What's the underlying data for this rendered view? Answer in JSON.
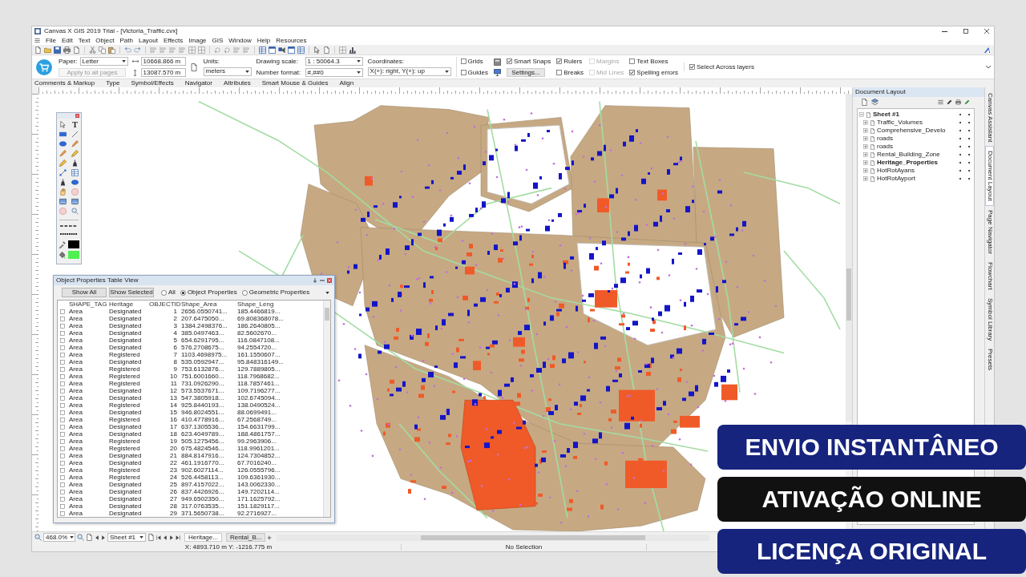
{
  "window": {
    "title": "Canvas X GIS 2019 Trial - [Victoria_Traffic.cvx]"
  },
  "menu": [
    "File",
    "Edit",
    "Text",
    "Object",
    "Path",
    "Layout",
    "Effects",
    "Image",
    "GIS",
    "Window",
    "Help",
    "Resources"
  ],
  "ribbon": {
    "paper": {
      "label": "Paper:",
      "value": "Letter"
    },
    "apply_button": {
      "label": "Apply to all pages",
      "disabled": true
    },
    "width": "10668.866 m",
    "height": "13087.570 m",
    "units": {
      "label": "Units:",
      "value": "meters"
    },
    "drawing_scale": {
      "label": "Drawing scale:",
      "value": "1 : 50064.3"
    },
    "number_format": {
      "label": "Number format:",
      "value": "#,##0"
    },
    "coordinates": {
      "label": "Coordinates:",
      "value": "X(+): right, Y(+): up"
    },
    "option_columns": [
      [
        {
          "kind": "checkbox",
          "label": "Grids",
          "checked": false,
          "disabled": false
        },
        {
          "kind": "checkbox",
          "label": "Guides",
          "checked": false,
          "disabled": false
        }
      ],
      [
        {
          "kind": "checkbox",
          "label": "Smart Snaps",
          "checked": true,
          "disabled": false
        },
        {
          "kind": "button",
          "label": "Settings..."
        }
      ],
      [
        {
          "kind": "checkbox",
          "label": "Rulers",
          "checked": true,
          "disabled": false
        },
        {
          "kind": "checkbox",
          "label": "Breaks",
          "checked": false,
          "disabled": false
        }
      ],
      [
        {
          "kind": "checkbox",
          "label": "Margins",
          "checked": false,
          "disabled": true
        },
        {
          "kind": "checkbox",
          "label": "Mid Lines",
          "checked": false,
          "disabled": true
        }
      ],
      [
        {
          "kind": "checkbox",
          "label": "Text Boxes",
          "checked": false,
          "disabled": false
        },
        {
          "kind": "checkbox",
          "label": "Spelling errors",
          "checked": true,
          "disabled": false
        }
      ],
      [
        {
          "kind": "checkbox",
          "label": "Select Across layers",
          "checked": true,
          "disabled": false
        }
      ]
    ]
  },
  "ribbon_tabs": [
    "Comments & Markup",
    "Type",
    "Symbol/Effects",
    "Navigator",
    "Attributes",
    "Smart Mouse & Guides",
    "Align"
  ],
  "toolbox": {
    "text_tool": "T"
  },
  "table_view": {
    "title": "Object Properties Table View",
    "buttons": [
      "Show All",
      "Show Selected"
    ],
    "radios": [
      {
        "label": "All",
        "selected": false
      },
      {
        "label": "Object Properties",
        "selected": true
      },
      {
        "label": "Geometric Properties",
        "selected": false
      }
    ],
    "columns": [
      "SHAPE_TAG",
      "Heritage",
      "OBJECTID",
      "Shape_Area",
      "Shape_Leng"
    ],
    "rows": [
      {
        "checked": false,
        "cells": [
          "Area",
          "Designated",
          "1",
          "2656.0550741...",
          "185.4466819..."
        ]
      },
      {
        "checked": false,
        "cells": [
          "Area",
          "Designated",
          "2",
          "207.6475050...",
          "69.808368078..."
        ]
      },
      {
        "checked": false,
        "cells": [
          "Area",
          "Designated",
          "3",
          "1384.2498376...",
          "186.2640805..."
        ]
      },
      {
        "checked": false,
        "cells": [
          "Area",
          "Designated",
          "4",
          "385.0497463...",
          "82.5602670..."
        ]
      },
      {
        "checked": false,
        "cells": [
          "Area",
          "Designated",
          "5",
          "654.6291795...",
          "116.0847108..."
        ]
      },
      {
        "checked": false,
        "cells": [
          "Area",
          "Designated",
          "6",
          "576.2708675...",
          "94.2554720..."
        ]
      },
      {
        "checked": false,
        "cells": [
          "Area",
          "Registered",
          "7",
          "1103.4698975...",
          "161.1550607..."
        ]
      },
      {
        "checked": false,
        "cells": [
          "Area",
          "Designated",
          "8",
          "535.0592947...",
          "95.848316149..."
        ]
      },
      {
        "checked": false,
        "cells": [
          "Area",
          "Registered",
          "9",
          "753.6132876...",
          "129.7889805..."
        ]
      },
      {
        "checked": false,
        "cells": [
          "Area",
          "Registered",
          "10",
          "751.6001660...",
          "118.7968682..."
        ]
      },
      {
        "checked": false,
        "cells": [
          "Area",
          "Registered",
          "11",
          "731.0926290...",
          "118.7857461..."
        ]
      },
      {
        "checked": false,
        "cells": [
          "Area",
          "Designated",
          "12",
          "573.5537671...",
          "109.7196277..."
        ]
      },
      {
        "checked": false,
        "cells": [
          "Area",
          "Designated",
          "13",
          "547.3805918...",
          "102.6745094..."
        ]
      },
      {
        "checked": false,
        "cells": [
          "Area",
          "Registered",
          "14",
          "925.8440193...",
          "138.0490524..."
        ]
      },
      {
        "checked": false,
        "cells": [
          "Area",
          "Designated",
          "15",
          "946.8024551...",
          "88.0699491..."
        ]
      },
      {
        "checked": false,
        "cells": [
          "Area",
          "Registered",
          "16",
          "410.4778916...",
          "67.2568749..."
        ]
      },
      {
        "checked": false,
        "cells": [
          "Area",
          "Designated",
          "17",
          "637.1305536...",
          "154.6631799..."
        ]
      },
      {
        "checked": false,
        "cells": [
          "Area",
          "Designated",
          "18",
          "623.4049789...",
          "188.4861757..."
        ]
      },
      {
        "checked": false,
        "cells": [
          "Area",
          "Registered",
          "19",
          "505.1275456...",
          "99.2963906..."
        ]
      },
      {
        "checked": false,
        "cells": [
          "Area",
          "Registered",
          "20",
          "675.4824546...",
          "118.9961201..."
        ]
      },
      {
        "checked": false,
        "cells": [
          "Area",
          "Designated",
          "21",
          "884.8147916...",
          "124.7304852..."
        ]
      },
      {
        "checked": false,
        "cells": [
          "Area",
          "Designated",
          "22",
          "461.1916770...",
          "67.7016240..."
        ]
      },
      {
        "checked": false,
        "cells": [
          "Area",
          "Registered",
          "23",
          "902.6027114...",
          "126.0555796..."
        ]
      },
      {
        "checked": false,
        "cells": [
          "Area",
          "Registered",
          "24",
          "526.4458113...",
          "109.6361930..."
        ]
      },
      {
        "checked": false,
        "cells": [
          "Area",
          "Designated",
          "25",
          "897.4157022...",
          "143.0062330..."
        ]
      },
      {
        "checked": false,
        "cells": [
          "Area",
          "Designated",
          "26",
          "837.4426926...",
          "149.7202114..."
        ]
      },
      {
        "checked": false,
        "cells": [
          "Area",
          "Designated",
          "27",
          "949.6502350...",
          "171.1625792..."
        ]
      },
      {
        "checked": false,
        "cells": [
          "Area",
          "Designated",
          "28",
          "317.0763535...",
          "151.1829117..."
        ]
      },
      {
        "checked": false,
        "cells": [
          "Area",
          "Designated",
          "29",
          "371.5650738...",
          "92.2716927..."
        ]
      }
    ]
  },
  "document_layout": {
    "title": "Document Layout",
    "tree": [
      {
        "name": "Sheet #1",
        "expanded": true,
        "visible": true,
        "printable": true,
        "children": [
          {
            "name": "Traffic_Volumes",
            "expanded": false,
            "active": false,
            "visible": true,
            "printable": true
          },
          {
            "name": "Comprehensive_Develo",
            "expanded": false,
            "active": false,
            "visible": true,
            "printable": true
          },
          {
            "name": "roads",
            "expanded": false,
            "active": false,
            "visible": true,
            "printable": true
          },
          {
            "name": "roads",
            "expanded": false,
            "active": false,
            "visible": true,
            "printable": true
          },
          {
            "name": "Rental_Building_Zone",
            "expanded": false,
            "active": false,
            "visible": true,
            "printable": true
          },
          {
            "name": "Heritage_Properties",
            "expanded": false,
            "active": true,
            "visible": true,
            "printable": true
          },
          {
            "name": "HotRotAyans",
            "expanded": false,
            "active": false,
            "visible": true,
            "printable": true
          },
          {
            "name": "HotRotAyport",
            "expanded": false,
            "active": false,
            "visible": true,
            "printable": true
          }
        ]
      }
    ]
  },
  "side_tabs": [
    {
      "label": "Canvas Assistant",
      "selected": false
    },
    {
      "label": "Document Layout",
      "selected": true
    },
    {
      "label": "Page Navigator",
      "selected": false
    },
    {
      "label": "Flowchart",
      "selected": false
    },
    {
      "label": "Symbol Library",
      "selected": false
    },
    {
      "label": "Presets",
      "selected": false
    }
  ],
  "status_bar": {
    "zoom": "468.0%",
    "page": "Sheet #1",
    "sheet_tabs": [
      {
        "label": "Heritage...",
        "selected": true
      },
      {
        "label": "Rental_B...",
        "selected": false
      }
    ],
    "coordinates": "X: 4893.710 m Y: -1216.775 m",
    "selection": "No Selection"
  },
  "promo_banners": [
    {
      "text": "ENVIO INSTANTÂNEO",
      "color": "#16247e"
    },
    {
      "text": "ATIVAÇÃO ONLINE",
      "color": "#111111"
    },
    {
      "text": "LICENÇA ORIGINAL",
      "color": "#16247e"
    }
  ]
}
